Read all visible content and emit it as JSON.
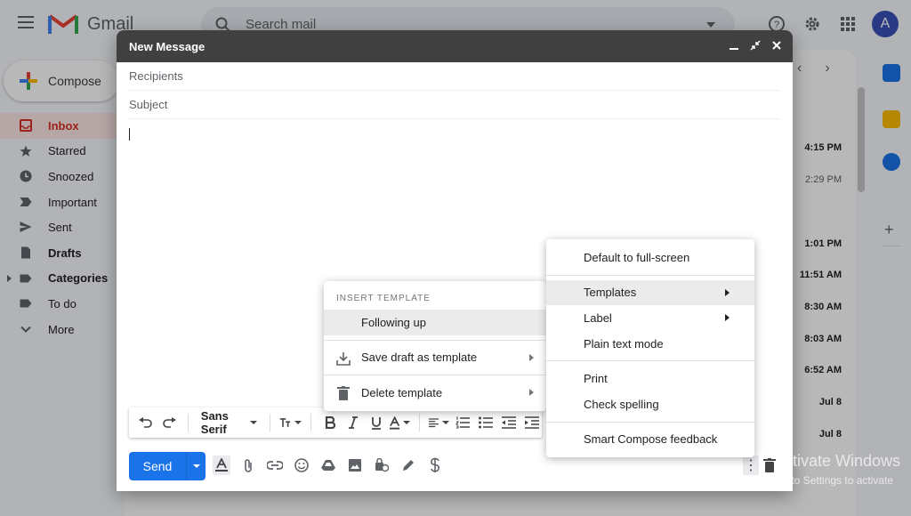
{
  "gmail": {
    "logo_text": "Gmail",
    "search_placeholder": "Search mail",
    "compose_label": "Compose",
    "avatar_letter": "A",
    "sidebar": [
      {
        "label": "Inbox",
        "icon": "inbox-icon"
      },
      {
        "label": "Starred",
        "icon": "star-icon"
      },
      {
        "label": "Snoozed",
        "icon": "clock-icon"
      },
      {
        "label": "Important",
        "icon": "important-icon"
      },
      {
        "label": "Sent",
        "icon": "send-icon"
      },
      {
        "label": "Drafts",
        "icon": "draft-icon"
      },
      {
        "label": "Categories",
        "icon": "label-icon"
      },
      {
        "label": "To do",
        "icon": "label-icon"
      },
      {
        "label": "More",
        "icon": "chevron-down-icon"
      }
    ],
    "times": [
      "4:15 PM",
      "2:29 PM",
      "1:01 PM",
      "11:51 AM",
      "8:30 AM",
      "8:03 AM",
      "6:52 AM",
      "Jul 8",
      "Jul 8"
    ],
    "colors": {
      "accent": "#1a73e8",
      "inbox": "#d93025",
      "header": "#404040"
    }
  },
  "compose": {
    "title": "New Message",
    "recipients_placeholder": "Recipients",
    "subject_placeholder": "Subject",
    "font_name": "Sans Serif",
    "send_label": "Send"
  },
  "more_menu": {
    "items": [
      "Default to full-screen",
      "Templates",
      "Label",
      "Plain text mode",
      "Print",
      "Check spelling",
      "Smart Compose feedback"
    ]
  },
  "template_menu": {
    "heading": "INSERT TEMPLATE",
    "items": [
      "Following up",
      "Save draft as template",
      "Delete template"
    ]
  },
  "watermark": {
    "line1": "Activate Windows",
    "line2": "Go to Settings to activate"
  }
}
